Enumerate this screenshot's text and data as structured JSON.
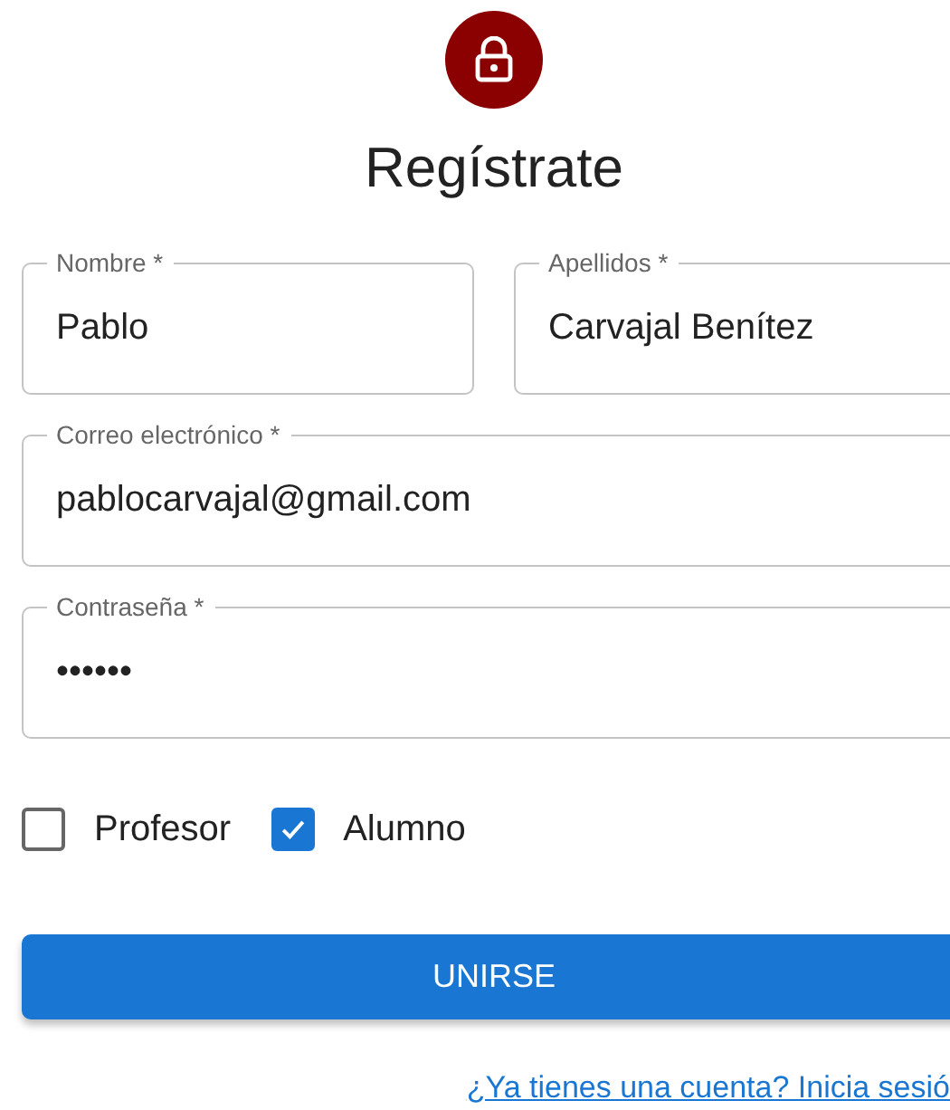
{
  "title": "Regístrate",
  "name_row": [
    {
      "label": "Nombre *",
      "value": "Pablo"
    },
    {
      "label": "Apellidos *",
      "value": "Carvajal Benítez"
    }
  ],
  "fields": [
    {
      "label": "Correo electrónico *",
      "value": "pablocarvajal@gmail.com"
    },
    {
      "label": "Contraseña *",
      "value": "••••••"
    }
  ],
  "checkboxes": [
    {
      "label": "Profesor",
      "checked": false
    },
    {
      "label": "Alumno",
      "checked": true
    }
  ],
  "button": "UNIRSE",
  "link": "¿Ya tienes una cuenta? Inicia sesió"
}
